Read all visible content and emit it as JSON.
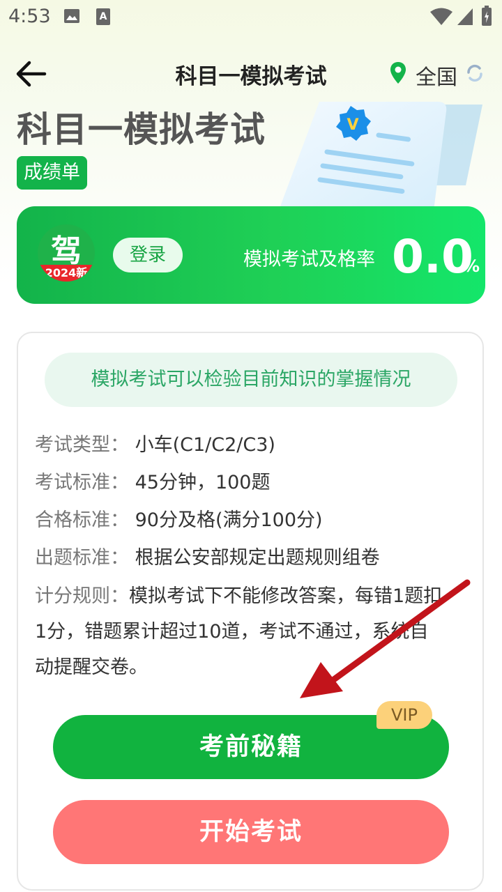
{
  "status_bar": {
    "time": "4:53"
  },
  "header": {
    "title": "科目一模拟考试",
    "location": "全国"
  },
  "hero": {
    "title": "科目一模拟考试",
    "badge": "成绩单"
  },
  "score_card": {
    "logo_char": "驾",
    "logo_band": "2024新",
    "login_label": "登录",
    "pass_rate_label": "模拟考试及格率",
    "pass_rate_value": "0.0",
    "pass_rate_unit": "%"
  },
  "info": {
    "tip": "模拟考试可以检验目前知识的掌握情况",
    "rows": [
      {
        "label": "考试类型：",
        "value": "小车(C1/C2/C3)"
      },
      {
        "label": "考试标准：",
        "value": "45分钟，100题"
      },
      {
        "label": "合格标准：",
        "value": "90分及格(满分100分)"
      },
      {
        "label": "出题标准：",
        "value": "根据公安部规定出题规则组卷"
      }
    ],
    "rule_label": "计分规则：",
    "rule_text": "模拟考试下不能修改答案，每错1题扣1分，错题累计超过10道，考试不通过，系统自动提醒交卷。"
  },
  "buttons": {
    "secret": "考前秘籍",
    "vip": "VIP",
    "start": "开始考试"
  },
  "colors": {
    "primary_green": "#11b33f",
    "start_red": "#ff7676",
    "vip_gold": "#fcd17a",
    "annotation_arrow": "#c2141b"
  }
}
